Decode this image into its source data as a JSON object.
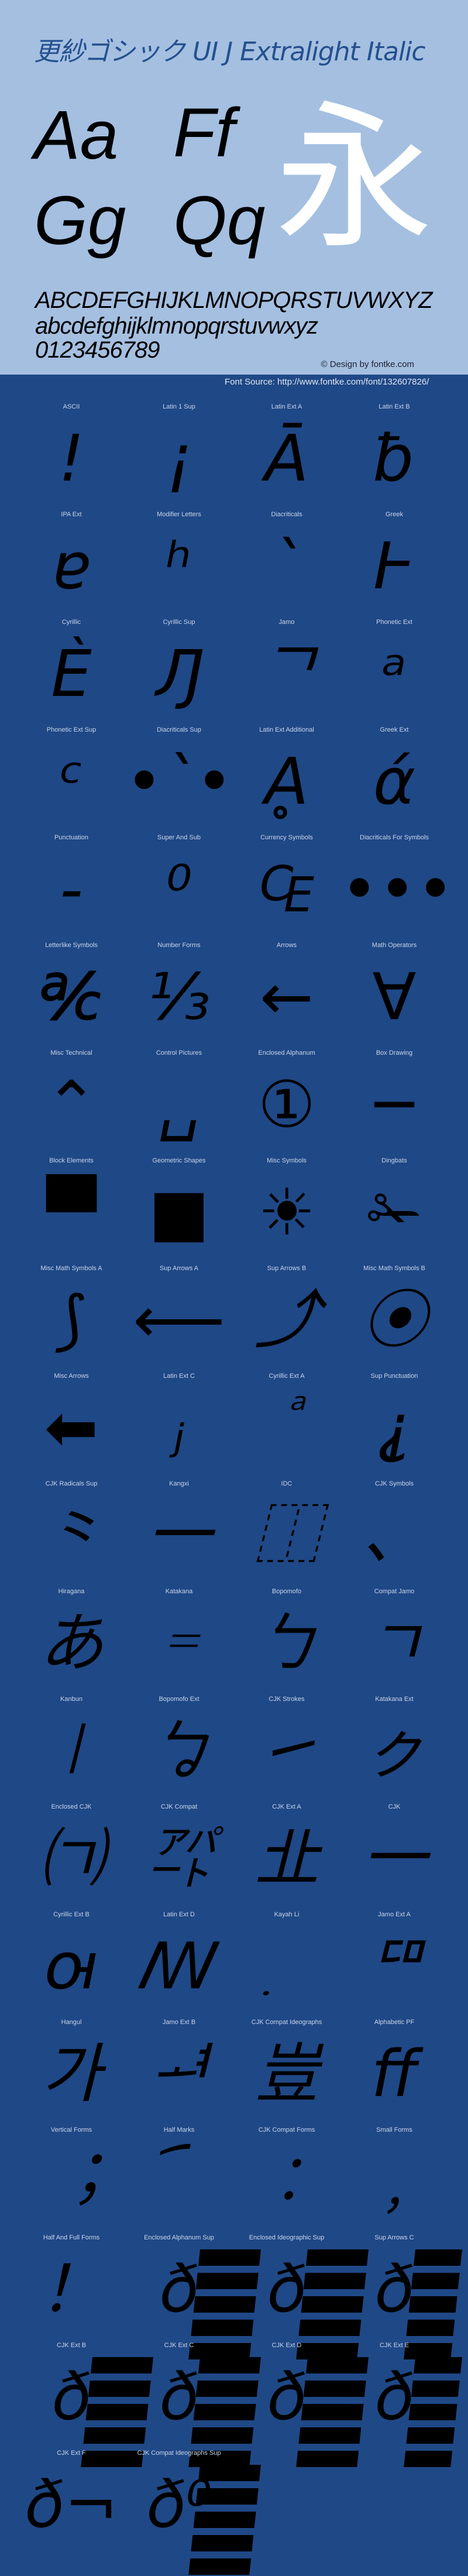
{
  "header": {
    "title": "更紗ゴシック UI J Extralight Italic",
    "specimen": [
      "Aa",
      "Ff",
      "Gg",
      "Qq"
    ],
    "kanji": "永",
    "uppercase": "ABCDEFGHIJKLMNOPQRSTUVWXYZ",
    "lowercase": "abcdefghijklmnopqrstuvwxyz",
    "digits": "0123456789",
    "copyright": "© Design by fontke.com",
    "source": "Font Source: http://www.fontke.com/font/132607826/"
  },
  "colors": {
    "header_bg": "#a4bfe0",
    "body_bg": "#1f4886",
    "title": "#24508f",
    "kanji": "#ffffff",
    "glyph": "#000000"
  },
  "blocks": [
    {
      "label": "ASCII",
      "glyph": "!"
    },
    {
      "label": "Latin 1 Sup",
      "glyph": "¡"
    },
    {
      "label": "Latin Ext A",
      "glyph": "Ā"
    },
    {
      "label": "Latin Ext B",
      "glyph": "ƀ"
    },
    {
      "label": "IPA Ext",
      "glyph": "ɐ"
    },
    {
      "label": "Modifier Letters",
      "glyph": "ʰ"
    },
    {
      "label": "Diacriticals",
      "glyph": "`"
    },
    {
      "label": "Greek",
      "glyph": "Ͱ"
    },
    {
      "label": "Cyrillic",
      "glyph": "Ѐ"
    },
    {
      "label": "Cyrillic Sup",
      "glyph": "Ԓ"
    },
    {
      "label": "Jamo",
      "glyph": "ᄀ"
    },
    {
      "label": "Phonetic Ext",
      "glyph": "ᵃ"
    },
    {
      "label": "Phonetic Ext Sup",
      "glyph": "ᶜ"
    },
    {
      "label": "Diacriticals Sup",
      "glyph": "•`•"
    },
    {
      "label": "Latin Ext Additional",
      "glyph": "Ḁ"
    },
    {
      "label": "Greek Ext",
      "glyph": "ά"
    },
    {
      "label": "Punctuation",
      "glyph": "‐"
    },
    {
      "label": "Super And Sub",
      "glyph": "⁰"
    },
    {
      "label": "Currency Symbols",
      "glyph": "₠"
    },
    {
      "label": "Diacriticals For Symbols",
      "glyph": "•••"
    },
    {
      "label": "Letterlike Symbols",
      "glyph": "℀"
    },
    {
      "label": "Number Forms",
      "glyph": "⅓"
    },
    {
      "label": "Arrows",
      "glyph": "←"
    },
    {
      "label": "Math Operators",
      "glyph": "∀"
    },
    {
      "label": "Misc Technical",
      "glyph": "⌃"
    },
    {
      "label": "Control Pictures",
      "glyph": "␣"
    },
    {
      "label": "Enclosed Alphanum",
      "glyph": "①"
    },
    {
      "label": "Box Drawing",
      "glyph": "─"
    },
    {
      "label": "Block Elements",
      "glyph": "▀"
    },
    {
      "label": "Geometric Shapes",
      "glyph": "■"
    },
    {
      "label": "Misc Symbols",
      "glyph": "☀"
    },
    {
      "label": "Dingbats",
      "glyph": "✁"
    },
    {
      "label": "Misc Math Symbols A",
      "glyph": "⟆"
    },
    {
      "label": "Sup Arrows A",
      "glyph": "⟵"
    },
    {
      "label": "Sup Arrows B",
      "glyph": "⤴"
    },
    {
      "label": "Misc Math Symbols B",
      "glyph": "⦿"
    },
    {
      "label": "Misc Arrows",
      "glyph": "⬅"
    },
    {
      "label": "Latin Ext C",
      "glyph": "ⱼ"
    },
    {
      "label": "Cyrillic Ext A",
      "glyph": "ⷶ"
    },
    {
      "label": "Sup Punctuation",
      "glyph": "⸘"
    },
    {
      "label": "CJK Radicals Sup",
      "glyph": "⺀"
    },
    {
      "label": "Kangxi",
      "glyph": "⼀"
    },
    {
      "label": "IDC",
      "glyph": "⿰"
    },
    {
      "label": "CJK Symbols",
      "glyph": "、"
    },
    {
      "label": "Hiragana",
      "glyph": "あ"
    },
    {
      "label": "Katakana",
      "glyph": "゠"
    },
    {
      "label": "Bopomofo",
      "glyph": "ㄅ"
    },
    {
      "label": "Compat Jamo",
      "glyph": "ㄱ"
    },
    {
      "label": "Kanbun",
      "glyph": "㆐"
    },
    {
      "label": "Bopomofo Ext",
      "glyph": "ㆠ"
    },
    {
      "label": "CJK Strokes",
      "glyph": "㇀"
    },
    {
      "label": "Katakana Ext",
      "glyph": "ㇰ"
    },
    {
      "label": "Enclosed CJK",
      "glyph": "㈀"
    },
    {
      "label": "CJK Compat",
      "glyph": "㌀"
    },
    {
      "label": "CJK Ext A",
      "glyph": "㐀"
    },
    {
      "label": "CJK",
      "glyph": "一"
    },
    {
      "label": "Cyrillic Ext B",
      "glyph": "ꙕ"
    },
    {
      "label": "Latin Ext D",
      "glyph": "ꟿ"
    },
    {
      "label": "Kayah Li",
      "glyph": "꤫"
    },
    {
      "label": "Jamo Ext A",
      "glyph": "ꥠ"
    },
    {
      "label": "Hangul",
      "glyph": "가"
    },
    {
      "label": "Jamo Ext B",
      "glyph": "ힰ"
    },
    {
      "label": "CJK Compat Ideographs",
      "glyph": "豈"
    },
    {
      "label": "Alphabetic PF",
      "glyph": "ﬀ"
    },
    {
      "label": "Vertical Forms",
      "glyph": "︔"
    },
    {
      "label": "Half Marks",
      "glyph": "︠"
    },
    {
      "label": "CJK Compat Forms",
      "glyph": "︰"
    },
    {
      "label": "Small Forms",
      "glyph": "﹐"
    },
    {
      "label": "Half And Full Forms",
      "glyph": "！"
    },
    {
      "label": "Enclosed Alphanum Sup",
      "glyph": "ð",
      "tofu": true
    },
    {
      "label": "Enclosed Ideographic Sup",
      "glyph": "ð",
      "tofu": true
    },
    {
      "label": "Sup Arrows C",
      "glyph": "ð",
      "tofu": true
    },
    {
      "label": "CJK Ext B",
      "glyph": "ð",
      "tofu": true
    },
    {
      "label": "CJK Ext C",
      "glyph": "ð",
      "tofu": true
    },
    {
      "label": "CJK Ext D",
      "glyph": "ð",
      "tofu": true
    },
    {
      "label": "CJK Ext E",
      "glyph": "ð",
      "tofu": true
    },
    {
      "label": "CJK Ext F",
      "glyph": "ð¬"
    },
    {
      "label": "CJK Compat Ideographs Sup",
      "glyph": "ð⁰",
      "tofu": true
    }
  ]
}
